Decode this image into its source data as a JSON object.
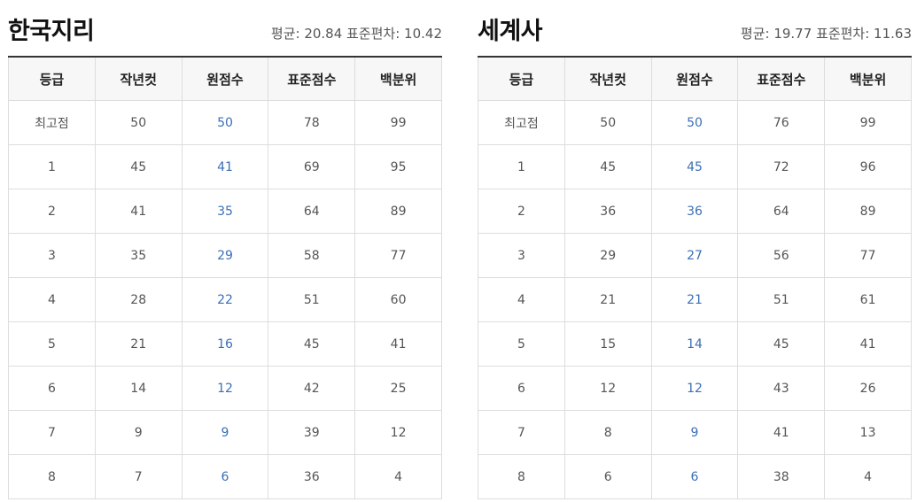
{
  "columns": [
    "등급",
    "작년컷",
    "원점수",
    "표준점수",
    "백분위"
  ],
  "panels": [
    {
      "title": "한국지리",
      "stats": "평균: 20.84 표준편차: 10.42",
      "rows": [
        [
          "최고점",
          "50",
          "50",
          "78",
          "99"
        ],
        [
          "1",
          "45",
          "41",
          "69",
          "95"
        ],
        [
          "2",
          "41",
          "35",
          "64",
          "89"
        ],
        [
          "3",
          "35",
          "29",
          "58",
          "77"
        ],
        [
          "4",
          "28",
          "22",
          "51",
          "60"
        ],
        [
          "5",
          "21",
          "16",
          "45",
          "41"
        ],
        [
          "6",
          "14",
          "12",
          "42",
          "25"
        ],
        [
          "7",
          "9",
          "9",
          "39",
          "12"
        ],
        [
          "8",
          "7",
          "6",
          "36",
          "4"
        ]
      ]
    },
    {
      "title": "세계사",
      "stats": "평균: 19.77 표준편차: 11.63",
      "rows": [
        [
          "최고점",
          "50",
          "50",
          "76",
          "99"
        ],
        [
          "1",
          "45",
          "45",
          "72",
          "96"
        ],
        [
          "2",
          "36",
          "36",
          "64",
          "89"
        ],
        [
          "3",
          "29",
          "27",
          "56",
          "77"
        ],
        [
          "4",
          "21",
          "21",
          "51",
          "61"
        ],
        [
          "5",
          "15",
          "14",
          "45",
          "41"
        ],
        [
          "6",
          "12",
          "12",
          "43",
          "26"
        ],
        [
          "7",
          "8",
          "9",
          "41",
          "13"
        ],
        [
          "8",
          "6",
          "6",
          "38",
          "4"
        ]
      ]
    }
  ],
  "colors": {
    "raw_score": "#3b6fb6",
    "header_bg": "#f7f7f7",
    "border": "#dddddd"
  }
}
